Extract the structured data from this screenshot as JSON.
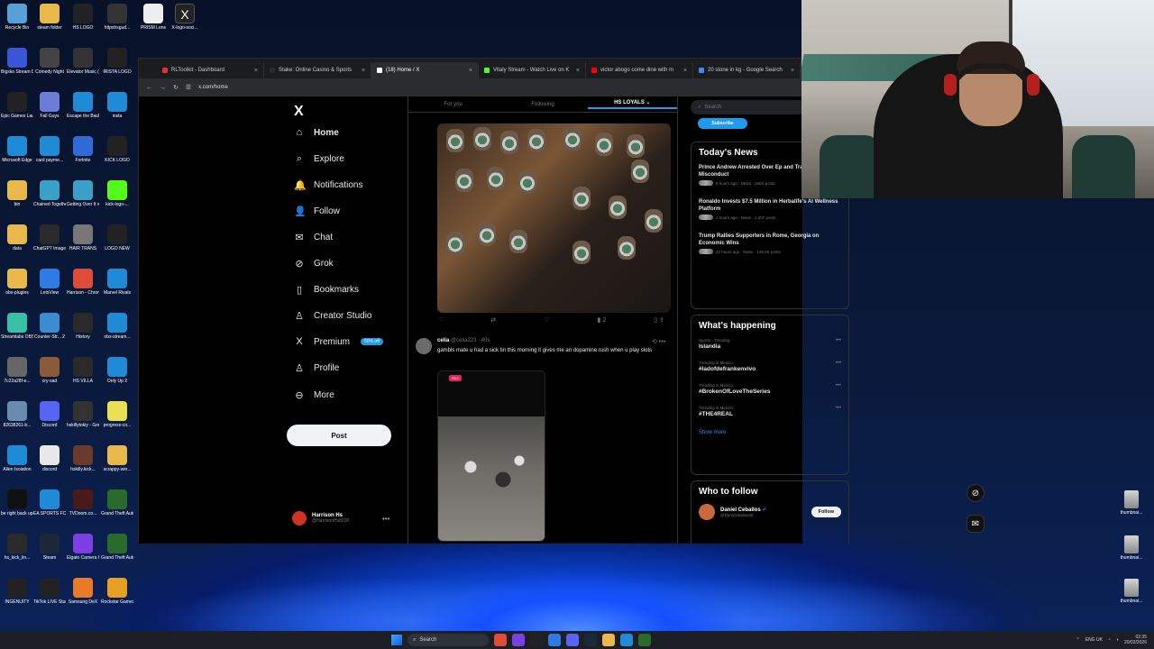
{
  "desktop": {
    "icons_col1": [
      {
        "label": "Recycle Bin",
        "color": "#5aa0d8"
      },
      {
        "label": "Bigsko Stream Deck",
        "color": "#3b55d6"
      },
      {
        "label": "Epic Games Launcher",
        "color": "#222222"
      },
      {
        "label": "Microsoft Edge",
        "color": "#1f8ad6"
      },
      {
        "label": "bin",
        "color": "#e8b84a"
      },
      {
        "label": "data",
        "color": "#e8b84a"
      },
      {
        "label": "obs-plugins",
        "color": "#e8b84a"
      },
      {
        "label": "Streamlabs OBS",
        "color": "#38c1a8"
      },
      {
        "label": "7c22a28f-e...",
        "color": "#666666"
      },
      {
        "label": "82638261-b...",
        "color": "#6a8bb0"
      },
      {
        "label": "Alien Isolation",
        "color": "#1f8ad6"
      },
      {
        "label": "be right back update",
        "color": "#111111"
      },
      {
        "label": "hs_kick_lin...",
        "color": "#2a2a2a"
      },
      {
        "label": "INGENUITY",
        "color": "#222222"
      }
    ],
    "icons_col2": [
      {
        "label": "steam folder",
        "color": "#e8b84a"
      },
      {
        "label": "Comedy Night",
        "color": "#444444"
      },
      {
        "label": "Fall Guys",
        "color": "#6b7cd9"
      },
      {
        "label": "card payme...",
        "color": "#1f8ad6"
      },
      {
        "label": "Chained Together",
        "color": "#3aa0c7"
      },
      {
        "label": "ChatGPT Image Jul 1...",
        "color": "#2a2a2a"
      },
      {
        "label": "LetsView",
        "color": "#2f7ae5"
      },
      {
        "label": "Counter-Str... 2",
        "color": "#3a8bd0"
      },
      {
        "label": "cry-sad",
        "color": "#8a5a3a"
      },
      {
        "label": "Discord",
        "color": "#5865f2"
      },
      {
        "label": "discord",
        "color": "#e8e8e8"
      },
      {
        "label": "EA SPORTS FC 25",
        "color": "#1f8ad6"
      },
      {
        "label": "Steam",
        "color": "#1b2838"
      },
      {
        "label": "TikTok LIVE Studio",
        "color": "#222222"
      }
    ],
    "icons_col3": [
      {
        "label": "HS LOGO",
        "color": "#222222"
      },
      {
        "label": "Elevator Music (Kev...",
        "color": "#333333"
      },
      {
        "label": "Escape the Backrooms",
        "color": "#1f8ad6"
      },
      {
        "label": "Fortnite",
        "color": "#2f6bd8"
      },
      {
        "label": "Getting Over It with Ben...",
        "color": "#3aa0c7"
      },
      {
        "label": "HAIR TRANS",
        "color": "#777777"
      },
      {
        "label": "Harrison - Chrome",
        "color": "#dd4b39"
      },
      {
        "label": "History",
        "color": "#2a2a2a"
      },
      {
        "label": "HS VILLA",
        "color": "#2a2a2a"
      },
      {
        "label": "hskillytokiy - General G...",
        "color": "#333333"
      },
      {
        "label": "hskilly.kick...",
        "color": "#6a3a2a"
      },
      {
        "label": "TVDoom.co...",
        "color": "#4a1a1a"
      },
      {
        "label": "Elgato Camera Hub",
        "color": "#7b3fe4"
      },
      {
        "label": "Samsung DeX",
        "color": "#e87a2a"
      }
    ],
    "icons_col4": [
      {
        "label": "httpshsgud...",
        "color": "#333333"
      },
      {
        "label": "IRISTA LOGO",
        "color": "#222222"
      },
      {
        "label": "insta",
        "color": "#1f8ad6"
      },
      {
        "label": "KICK LOGO",
        "color": "#222222"
      },
      {
        "label": "kick-logo-...",
        "color": "#53fc18"
      },
      {
        "label": "LOGO NEW",
        "color": "#222222"
      },
      {
        "label": "Marvel Rivals",
        "color": "#1f8ad6"
      },
      {
        "label": "obs-stream...",
        "color": "#1f8ad6"
      },
      {
        "label": "Only Up 2",
        "color": "#1f8ad6"
      },
      {
        "label": "progress-co...",
        "color": "#e8e050"
      },
      {
        "label": "scrappy-win...",
        "color": "#e8b84a"
      },
      {
        "label": "Grand Theft Auto V Le...",
        "color": "#2a6a2a"
      },
      {
        "label": "Grand Theft Auto V Enh...",
        "color": "#2a6a2a"
      },
      {
        "label": "Rockstar Games ...",
        "color": "#e8a020"
      }
    ],
    "icons_top": [
      {
        "label": "PRISM Lens",
        "color": "#eeeeee"
      },
      {
        "label": "X-logo-soci...",
        "color": "#222222"
      }
    ],
    "thumbnails": [
      "thumbnai...",
      "thumbnai...",
      "thumbnai..."
    ]
  },
  "browser": {
    "tabs": [
      {
        "title": "RLToolkit - Dashboard",
        "color": "#e03030"
      },
      {
        "title": "Stake: Online Casino & Sports",
        "color": "#2a2a2a"
      },
      {
        "title": "(18) Home / X",
        "color": "#ffffff",
        "active": true
      },
      {
        "title": "Vitaly Stream - Watch Live on K",
        "color": "#53fc18"
      },
      {
        "title": "victor abogo come dine with m",
        "color": "#ff0000"
      },
      {
        "title": "20 stone in kg - Google Search",
        "color": "#4285f4"
      }
    ],
    "url": "x.com/home"
  },
  "x": {
    "nav": [
      {
        "label": "Home",
        "icon": "home-icon",
        "glyph": "⌂"
      },
      {
        "label": "Explore",
        "icon": "search-icon",
        "glyph": "⌕"
      },
      {
        "label": "Notifications",
        "icon": "bell-icon",
        "glyph": "🔔"
      },
      {
        "label": "Follow",
        "icon": "follow-icon",
        "glyph": "👤"
      },
      {
        "label": "Chat",
        "icon": "mail-icon",
        "glyph": "✉"
      },
      {
        "label": "Grok",
        "icon": "grok-icon",
        "glyph": "⊘"
      },
      {
        "label": "Bookmarks",
        "icon": "bookmark-icon",
        "glyph": "▯"
      },
      {
        "label": "Creator Studio",
        "icon": "creator-icon",
        "glyph": "♙"
      },
      {
        "label": "Premium",
        "icon": "x-icon",
        "glyph": "X"
      },
      {
        "label": "Profile",
        "icon": "profile-icon",
        "glyph": "♙"
      },
      {
        "label": "More",
        "icon": "more-icon",
        "glyph": "⊖"
      }
    ],
    "premium_badge": "50% off",
    "post_label": "Post",
    "account": {
      "name": "Harrison Hs",
      "handle": "@HarrisonHs8238"
    },
    "feed_tabs": [
      "For you",
      "Following",
      "HS LOYALS"
    ],
    "tweet2": {
      "name": "celia",
      "handle": "@celia223 · 40s",
      "text": "gambls mate u had a sick tin this morning it gives me an dopamine rush when u play slots",
      "rec": "REC"
    },
    "media_views": "2",
    "search_placeholder": "Search",
    "subscribe_label": "Subscribe",
    "todays_news": {
      "title": "Today's News",
      "items": [
        {
          "title": "Prince Andrew Arrested Over Ep and Trade Envoy Misconduct",
          "meta": "9 hours ago · News · 155K posts"
        },
        {
          "title": "Ronaldo Invests $7.5 Million in Herbalife's AI Wellness Platform",
          "meta": "2 hours ago · News · 1,207 posts"
        },
        {
          "title": "Trump Rallies Supporters in Rome, Georgia on Economic Wins",
          "meta": "22 hours ago · News · 126.5K posts"
        }
      ]
    },
    "whats_happening": {
      "title": "What's happening",
      "trends": [
        {
          "context": "Sports · Trending",
          "name": "Islandia"
        },
        {
          "context": "Trending in Mexico",
          "name": "#ladofdefrankenvivo"
        },
        {
          "context": "Trending in Mexico",
          "name": "#BrokenOfLoveTheSeries"
        },
        {
          "context": "Trending in Mexico",
          "name": "#THE4REAL"
        }
      ],
      "show_more": "Show more"
    },
    "who_to_follow": {
      "title": "Who to follow",
      "name": "Daniel Ceballos",
      "handle": "@DaniCeballos46",
      "button": "Follow"
    }
  },
  "taskbar": {
    "search": "Search",
    "lang": "ENG UK",
    "time": "02:35",
    "date": "20/02/2026"
  }
}
